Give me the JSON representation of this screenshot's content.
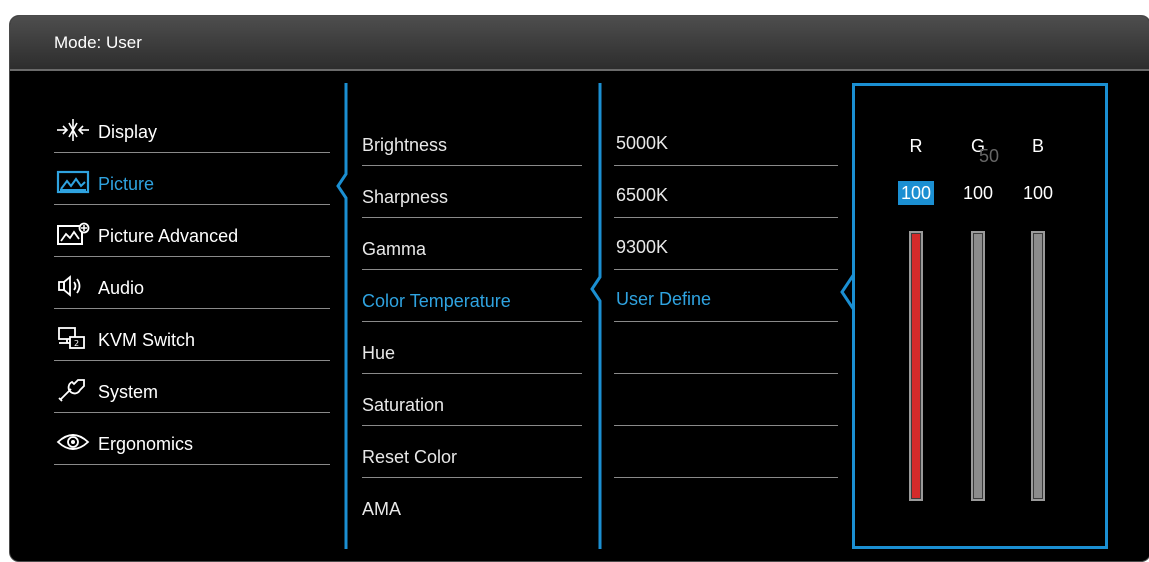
{
  "header": {
    "mode": "Mode: User"
  },
  "colors": {
    "accent": "#1b8fd2",
    "selected_text": "#2fa3e0",
    "red_channel": "#d42a2a",
    "gray_channel": "#8c8c8c"
  },
  "main_menu": [
    {
      "label": "Display",
      "icon": "display-arrows-icon"
    },
    {
      "label": "Picture",
      "icon": "picture-icon",
      "active": true
    },
    {
      "label": "Picture Advanced",
      "icon": "picture-advanced-icon"
    },
    {
      "label": "Audio",
      "icon": "speaker-icon"
    },
    {
      "label": "KVM Switch",
      "icon": "kvm-switch-icon"
    },
    {
      "label": "System",
      "icon": "wrench-icon"
    },
    {
      "label": "Ergonomics",
      "icon": "eye-icon"
    }
  ],
  "submenu": [
    {
      "label": "Brightness"
    },
    {
      "label": "Sharpness"
    },
    {
      "label": "Gamma"
    },
    {
      "label": "Color Temperature",
      "active": true
    },
    {
      "label": "Hue"
    },
    {
      "label": "Saturation"
    },
    {
      "label": "Reset Color"
    },
    {
      "label": "AMA"
    }
  ],
  "temperature_options": [
    {
      "label": "5000K"
    },
    {
      "label": "6500K"
    },
    {
      "label": "9300K"
    },
    {
      "label": "User Define",
      "active": true
    }
  ],
  "user_define": {
    "ghost_value": "50",
    "channels": [
      {
        "label": "R",
        "value": "100",
        "level": 1.0,
        "selected": true
      },
      {
        "label": "G",
        "value": "100",
        "level": 1.0
      },
      {
        "label": "B",
        "value": "100",
        "level": 1.0
      }
    ]
  }
}
